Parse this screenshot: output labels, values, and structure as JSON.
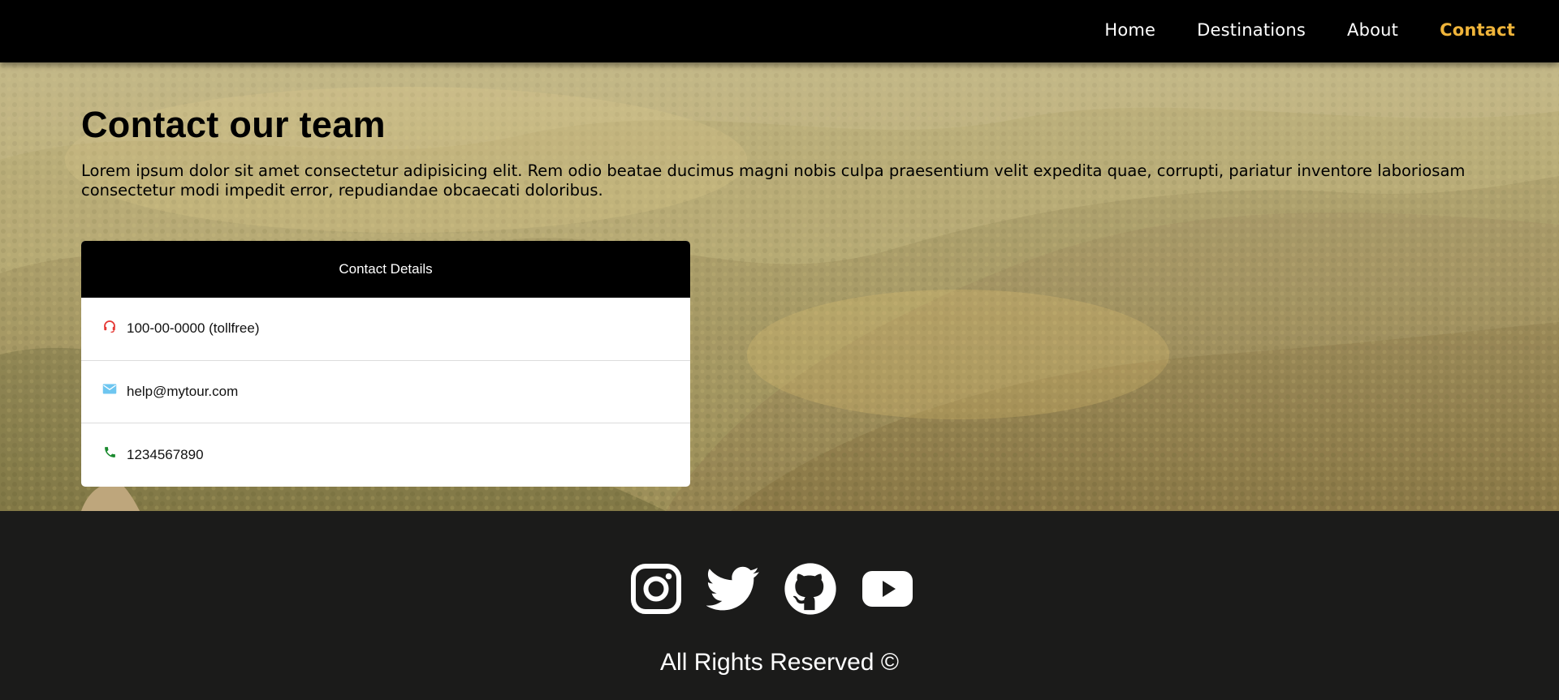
{
  "nav": {
    "items": [
      {
        "label": "Home",
        "active": false
      },
      {
        "label": "Destinations",
        "active": false
      },
      {
        "label": "About",
        "active": false
      },
      {
        "label": "Contact",
        "active": true
      }
    ],
    "active_color": "#efb43a"
  },
  "hero": {
    "title": "Contact our team",
    "intro": "Lorem ipsum dolor sit amet consectetur adipisicing elit. Rem odio beatae ducimus magni nobis culpa praesentium velit expedita quae, corrupti, pariatur inventore laboriosam consectetur modi impedit error, repudiandae obcaecati doloribus."
  },
  "contact_card": {
    "title": "Contact Details",
    "rows": [
      {
        "icon": "headset-icon",
        "text": "100-00-0000 (tollfree)",
        "icon_color": "#e53935"
      },
      {
        "icon": "mail-icon",
        "text": "help@mytour.com",
        "icon_color": "#6ec6f0"
      },
      {
        "icon": "phone-icon",
        "text": "1234567890",
        "icon_color": "#1a8a2e"
      }
    ]
  },
  "footer": {
    "socials": [
      "instagram-icon",
      "twitter-icon",
      "github-icon",
      "youtube-icon"
    ],
    "copyright": "All Rights Reserved ©"
  }
}
